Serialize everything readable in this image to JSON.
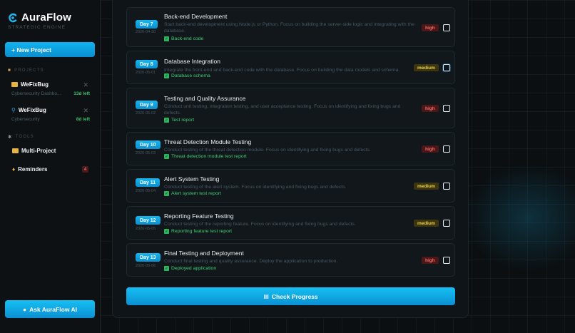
{
  "brand": {
    "name": "AuraFlow",
    "subtitle": "STRATEGIC ENGINE"
  },
  "sidebar": {
    "new_project_label": "+ New Project",
    "projects_label": "PROJECTS",
    "projects": [
      {
        "name": "WeFixBug",
        "subtitle": "Cybersecurity Dashbo...",
        "days_left": "13d left",
        "icon": "folder-icon"
      },
      {
        "name": "WeFixBug",
        "subtitle": "Cybersecurity",
        "days_left": "8d left",
        "icon": "search-icon"
      }
    ],
    "tools_label": "TOOLS",
    "tools": [
      {
        "label": "Multi-Project",
        "icon": "folder-icon"
      },
      {
        "label": "Reminders",
        "icon": "bell-icon",
        "count": "4"
      }
    ],
    "ask_ai_label": "Ask AuraFlow AI"
  },
  "tasks": [
    {
      "day": "Day 7",
      "date": "2026-04-30",
      "title": "Back-end Development",
      "description": "Start back-end development using Node.js or Python. Focus on building the server-side logic and integrating with the database.",
      "deliverable": "Back-end code",
      "priority": "high"
    },
    {
      "day": "Day 8",
      "date": "2026-05-01",
      "title": "Database Integration",
      "description": "Integrate the front-end and back-end code with the database. Focus on building the data models and schema.",
      "deliverable": "Database schema",
      "priority": "medium"
    },
    {
      "day": "Day 9",
      "date": "2026-05-02",
      "title": "Testing and Quality Assurance",
      "description": "Conduct unit testing, integration testing, and user acceptance testing. Focus on identifying and fixing bugs and defects.",
      "deliverable": "Test report",
      "priority": "high"
    },
    {
      "day": "Day 10",
      "date": "2026-05-03",
      "title": "Threat Detection Module Testing",
      "description": "Conduct testing of the threat detection module. Focus on identifying and fixing bugs and defects.",
      "deliverable": "Threat detection module test report",
      "priority": "high"
    },
    {
      "day": "Day 11",
      "date": "2026-05-04",
      "title": "Alert System Testing",
      "description": "Conduct testing of the alert system. Focus on identifying and fixing bugs and defects.",
      "deliverable": "Alert system test report",
      "priority": "medium"
    },
    {
      "day": "Day 12",
      "date": "2026-05-05",
      "title": "Reporting Feature Testing",
      "description": "Conduct testing of the reporting feature. Focus on identifying and fixing bugs and defects.",
      "deliverable": "Reporting feature test report",
      "priority": "medium"
    },
    {
      "day": "Day 13",
      "date": "2026-05-06",
      "title": "Final Testing and Deployment",
      "description": "Conduct final testing and quality assurance. Deploy the application to production.",
      "deliverable": "Deployed application",
      "priority": "high"
    }
  ],
  "main": {
    "check_progress_label": "Check Progress"
  },
  "colors": {
    "accent": "#0fb3ee",
    "high": "#f06a6a",
    "medium": "#ead34a",
    "deliverable": "#3fcf74"
  }
}
